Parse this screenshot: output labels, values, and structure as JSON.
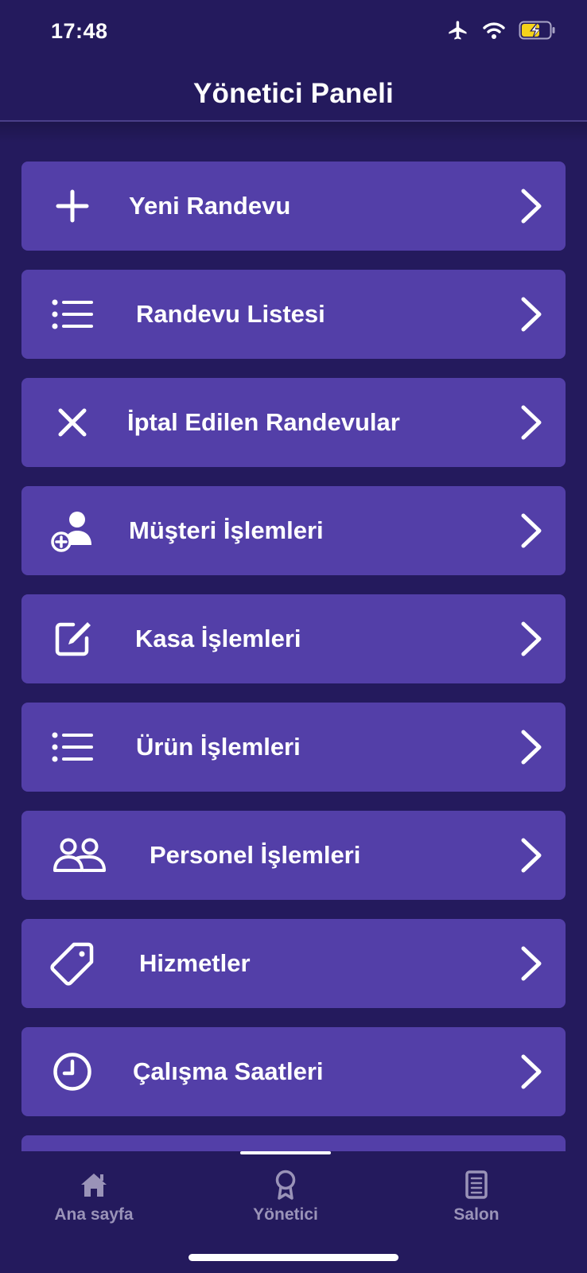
{
  "status_bar": {
    "time": "17:48",
    "icons": [
      "airplane-icon",
      "wifi-icon",
      "battery-charging-icon"
    ]
  },
  "header": {
    "title": "Yönetici Paneli"
  },
  "menu": {
    "items": [
      {
        "label": "Yeni Randevu",
        "icon": "plus-icon"
      },
      {
        "label": "Randevu Listesi",
        "icon": "list-icon"
      },
      {
        "label": "İptal Edilen Randevular",
        "icon": "close-icon"
      },
      {
        "label": "Müşteri İşlemleri",
        "icon": "add-person-icon"
      },
      {
        "label": "Kasa İşlemleri",
        "icon": "edit-square-icon"
      },
      {
        "label": "Ürün İşlemleri",
        "icon": "list-icon"
      },
      {
        "label": "Personel İşlemleri",
        "icon": "people-icon"
      },
      {
        "label": "Hizmetler",
        "icon": "tag-icon"
      },
      {
        "label": "Çalışma Saatleri",
        "icon": "clock-icon"
      }
    ]
  },
  "tab_bar": {
    "tabs": [
      {
        "label": "Ana sayfa",
        "icon": "home-icon",
        "active": false
      },
      {
        "label": "Yönetici",
        "icon": "badge-icon",
        "active": true
      },
      {
        "label": "Salon",
        "icon": "notebook-icon",
        "active": false
      }
    ]
  },
  "colors": {
    "background": "#241a5d",
    "menu_item": "#533fa8",
    "text": "#ffffff",
    "tab_inactive": "#9a93b8",
    "battery": "#f5d31a"
  }
}
